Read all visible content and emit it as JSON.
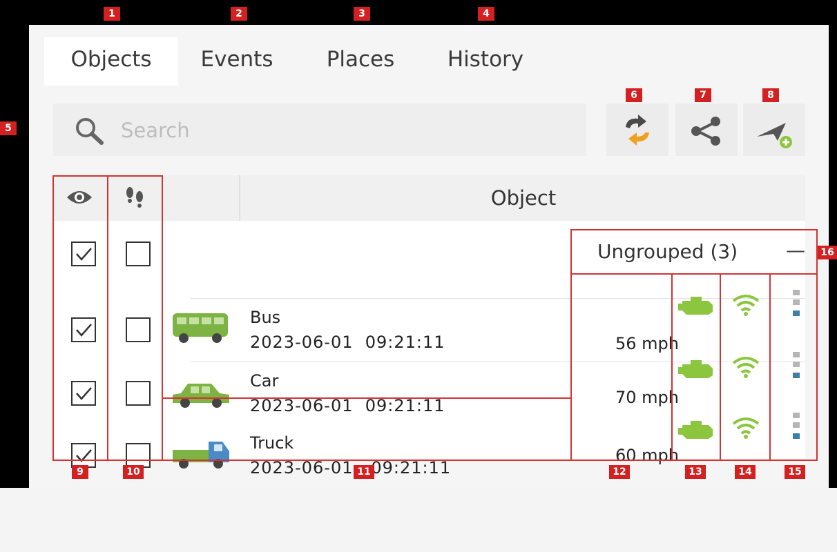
{
  "tabs": [
    {
      "label": "Objects",
      "active": true
    },
    {
      "label": "Events",
      "active": false
    },
    {
      "label": "Places",
      "active": false
    },
    {
      "label": "History",
      "active": false
    }
  ],
  "search": {
    "placeholder": "Search"
  },
  "toolbar": {
    "reload_icon": "refresh-arrows-icon",
    "share_icon": "share-icon",
    "add_icon": "add-object-icon"
  },
  "table": {
    "visibility_icon": "eye-icon",
    "follow_icon": "footprints-icon",
    "object_header": "Object",
    "group": {
      "label": "Ungrouped (3)",
      "collapse_symbol": "—"
    },
    "rows": [
      {
        "name": "Bus",
        "time": "2023-06-01  09:21:11",
        "speed": "56 mph",
        "icon": "bus-icon",
        "visible": true,
        "follow": false
      },
      {
        "name": "Car",
        "time": "2023-06-01  09:21:11",
        "speed": "70 mph",
        "icon": "car-icon",
        "visible": true,
        "follow": false
      },
      {
        "name": "Truck",
        "time": "2023-06-01   09:21:11",
        "speed": "60 mph",
        "icon": "truck-icon",
        "visible": true,
        "follow": false
      }
    ]
  },
  "annotations": [
    "1",
    "2",
    "3",
    "4",
    "5",
    "6",
    "7",
    "8",
    "9",
    "10",
    "11",
    "12",
    "13",
    "14",
    "15",
    "16"
  ],
  "colors": {
    "accent_green": "#8cc63f",
    "annotation_red": "#d42020",
    "menu_blue": "#3d7fa8"
  }
}
